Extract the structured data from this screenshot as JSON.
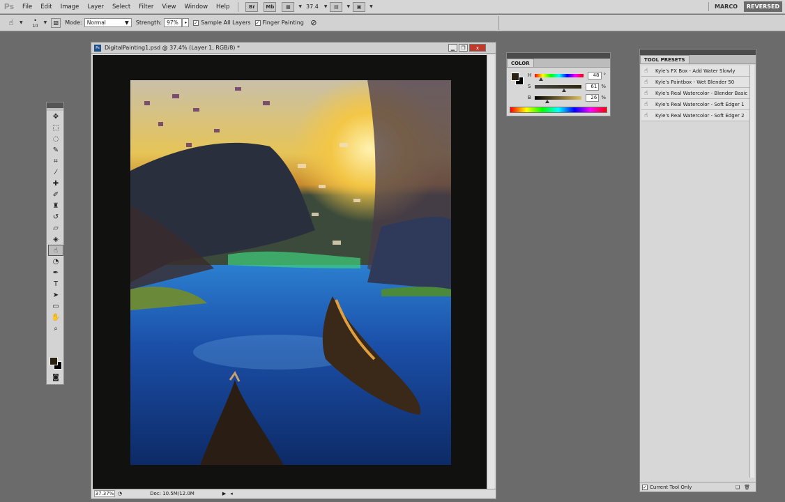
{
  "app": {
    "logo": "Ps"
  },
  "menu": [
    "File",
    "Edit",
    "Image",
    "Layer",
    "Select",
    "Filter",
    "View",
    "Window",
    "Help"
  ],
  "menubar": {
    "bridge_label": "Br",
    "mini_bridge_label": "Mb",
    "zoom": "37.4"
  },
  "workspace": {
    "user": "MARCO",
    "active": "REVERSED"
  },
  "options": {
    "brush_size": "10",
    "mode_label": "Mode:",
    "mode_value": "Normal",
    "strength_label": "Strength:",
    "strength_value": "97%",
    "sample_all_layers": "Sample All Layers",
    "finger_painting": "Finger Painting"
  },
  "document": {
    "title": "DigitalPainting1.psd @ 37.4% (Layer 1, RGB/8) *",
    "zoom": "37.37%",
    "doc_info": "Doc: 10.5M/12.0M",
    "close_label": "x"
  },
  "color_panel": {
    "tab": "COLOR",
    "rows": [
      {
        "label": "H",
        "value": "48",
        "unit": "°",
        "fraction": 0.13
      },
      {
        "label": "S",
        "value": "61",
        "unit": "%",
        "fraction": 0.61
      },
      {
        "label": "B",
        "value": "26",
        "unit": "%",
        "fraction": 0.26
      }
    ],
    "foreground": "#2b2110",
    "background": "#000000"
  },
  "tool_presets": {
    "tab": "TOOL PRESETS",
    "items": [
      "Kyle's FX Box - Add Water Slowly",
      "Kyle's Paintbox - Wet Blender 50",
      "Kyle's Real Watercolor - Blender Basic",
      "Kyle's Real Watercolor - Soft Edger 1",
      "Kyle's Real Watercolor - Soft Edger 2"
    ],
    "current_tool_only": "Current Tool Only"
  },
  "tools": [
    {
      "name": "move-tool",
      "glyph": "✥"
    },
    {
      "name": "marquee-tool",
      "glyph": "⬚"
    },
    {
      "name": "lasso-tool",
      "glyph": "◌"
    },
    {
      "name": "quick-select-tool",
      "glyph": "✎"
    },
    {
      "name": "crop-tool",
      "glyph": "⌗"
    },
    {
      "name": "eyedropper-tool",
      "glyph": "⁄"
    },
    {
      "name": "healing-tool",
      "glyph": "✚"
    },
    {
      "name": "brush-tool",
      "glyph": "✐"
    },
    {
      "name": "stamp-tool",
      "glyph": "♜"
    },
    {
      "name": "history-brush-tool",
      "glyph": "↺"
    },
    {
      "name": "eraser-tool",
      "glyph": "▱"
    },
    {
      "name": "bucket-tool",
      "glyph": "◈"
    },
    {
      "name": "smudge-tool",
      "glyph": "☝"
    },
    {
      "name": "dodge-tool",
      "glyph": "◔"
    },
    {
      "name": "pen-tool",
      "glyph": "✒"
    },
    {
      "name": "type-tool",
      "glyph": "T"
    },
    {
      "name": "path-select-tool",
      "glyph": "➤"
    },
    {
      "name": "shape-tool",
      "glyph": "▭"
    },
    {
      "name": "hand-tool",
      "glyph": "✋"
    },
    {
      "name": "zoom-tool",
      "glyph": "⌕"
    }
  ]
}
